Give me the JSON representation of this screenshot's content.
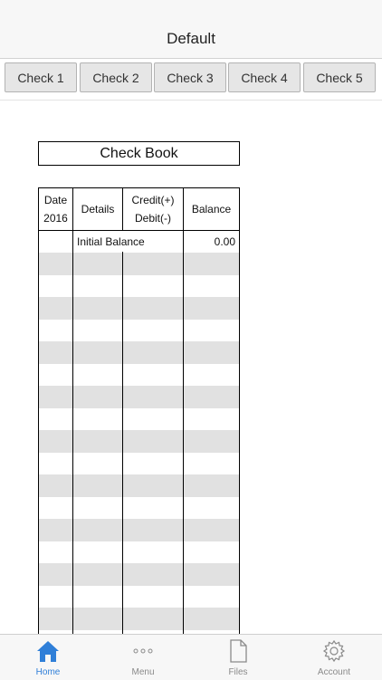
{
  "nav": {
    "title": "Default"
  },
  "tabs": [
    {
      "label": "Check 1"
    },
    {
      "label": "Check 2"
    },
    {
      "label": "Check 3"
    },
    {
      "label": "Check 4"
    },
    {
      "label": "Check 5"
    }
  ],
  "checkbook": {
    "title": "Check Book",
    "columns": {
      "date_line1": "Date",
      "date_line2": "2016",
      "details": "Details",
      "amount_line1": "Credit(+)",
      "amount_line2": "Debit(-)",
      "balance": "Balance"
    },
    "initial_row": {
      "details": "Initial Balance",
      "balance": "0.00"
    }
  },
  "tabbar": {
    "items": [
      {
        "label": "Home",
        "icon": "home-icon",
        "active": true
      },
      {
        "label": "Menu",
        "icon": "dots-icon",
        "active": false
      },
      {
        "label": "Files",
        "icon": "file-icon",
        "active": false
      },
      {
        "label": "Account",
        "icon": "gear-icon",
        "active": false
      }
    ],
    "active_color": "#2f7fd8",
    "inactive_color": "#8a8a8a"
  }
}
